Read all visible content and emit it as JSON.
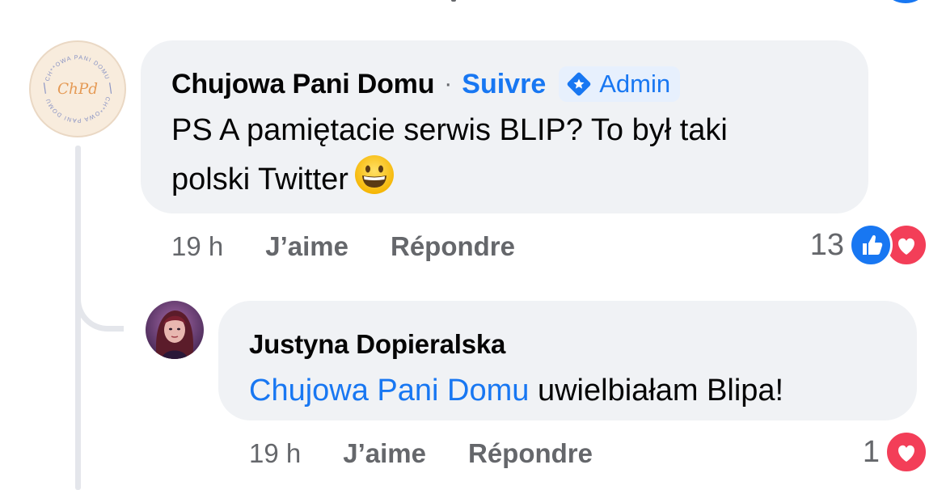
{
  "main_comment": {
    "author": "Chujowa Pani Domu",
    "separator": "·",
    "follow_label": "Suivre",
    "badge_label": "Admin",
    "badge_icon": "admin-star-diamond-icon",
    "text_line1": "PS A pamiętacie serwis BLIP? To był taki",
    "text_line2": "polski Twitter",
    "emoji": "grinning-face-icon",
    "time": "19 h",
    "like_label": "J’aime",
    "reply_label": "Répondre",
    "reaction_count": "13",
    "reactions": [
      "like-icon",
      "love-icon"
    ],
    "avatar": {
      "ring_text_top": "CH**OWA PANI DOMU",
      "ring_text_bottom": "CH**OWA PANI DOMU",
      "monogram": "ChPd"
    }
  },
  "reply_comment": {
    "author": "Justyna Dopieralska",
    "mention": "Chujowa Pani Domu",
    "text": "uwielbiałam Blipa!",
    "time": "19 h",
    "like_label": "J’aime",
    "reply_label": "Répondre",
    "reaction_count": "1",
    "reactions": [
      "love-icon"
    ]
  },
  "colors": {
    "bubble_bg": "#f0f2f5",
    "link_blue": "#1877f2",
    "meta_gray": "#65676b",
    "love_red": "#f33e58",
    "thread_line": "#e4e6eb"
  }
}
